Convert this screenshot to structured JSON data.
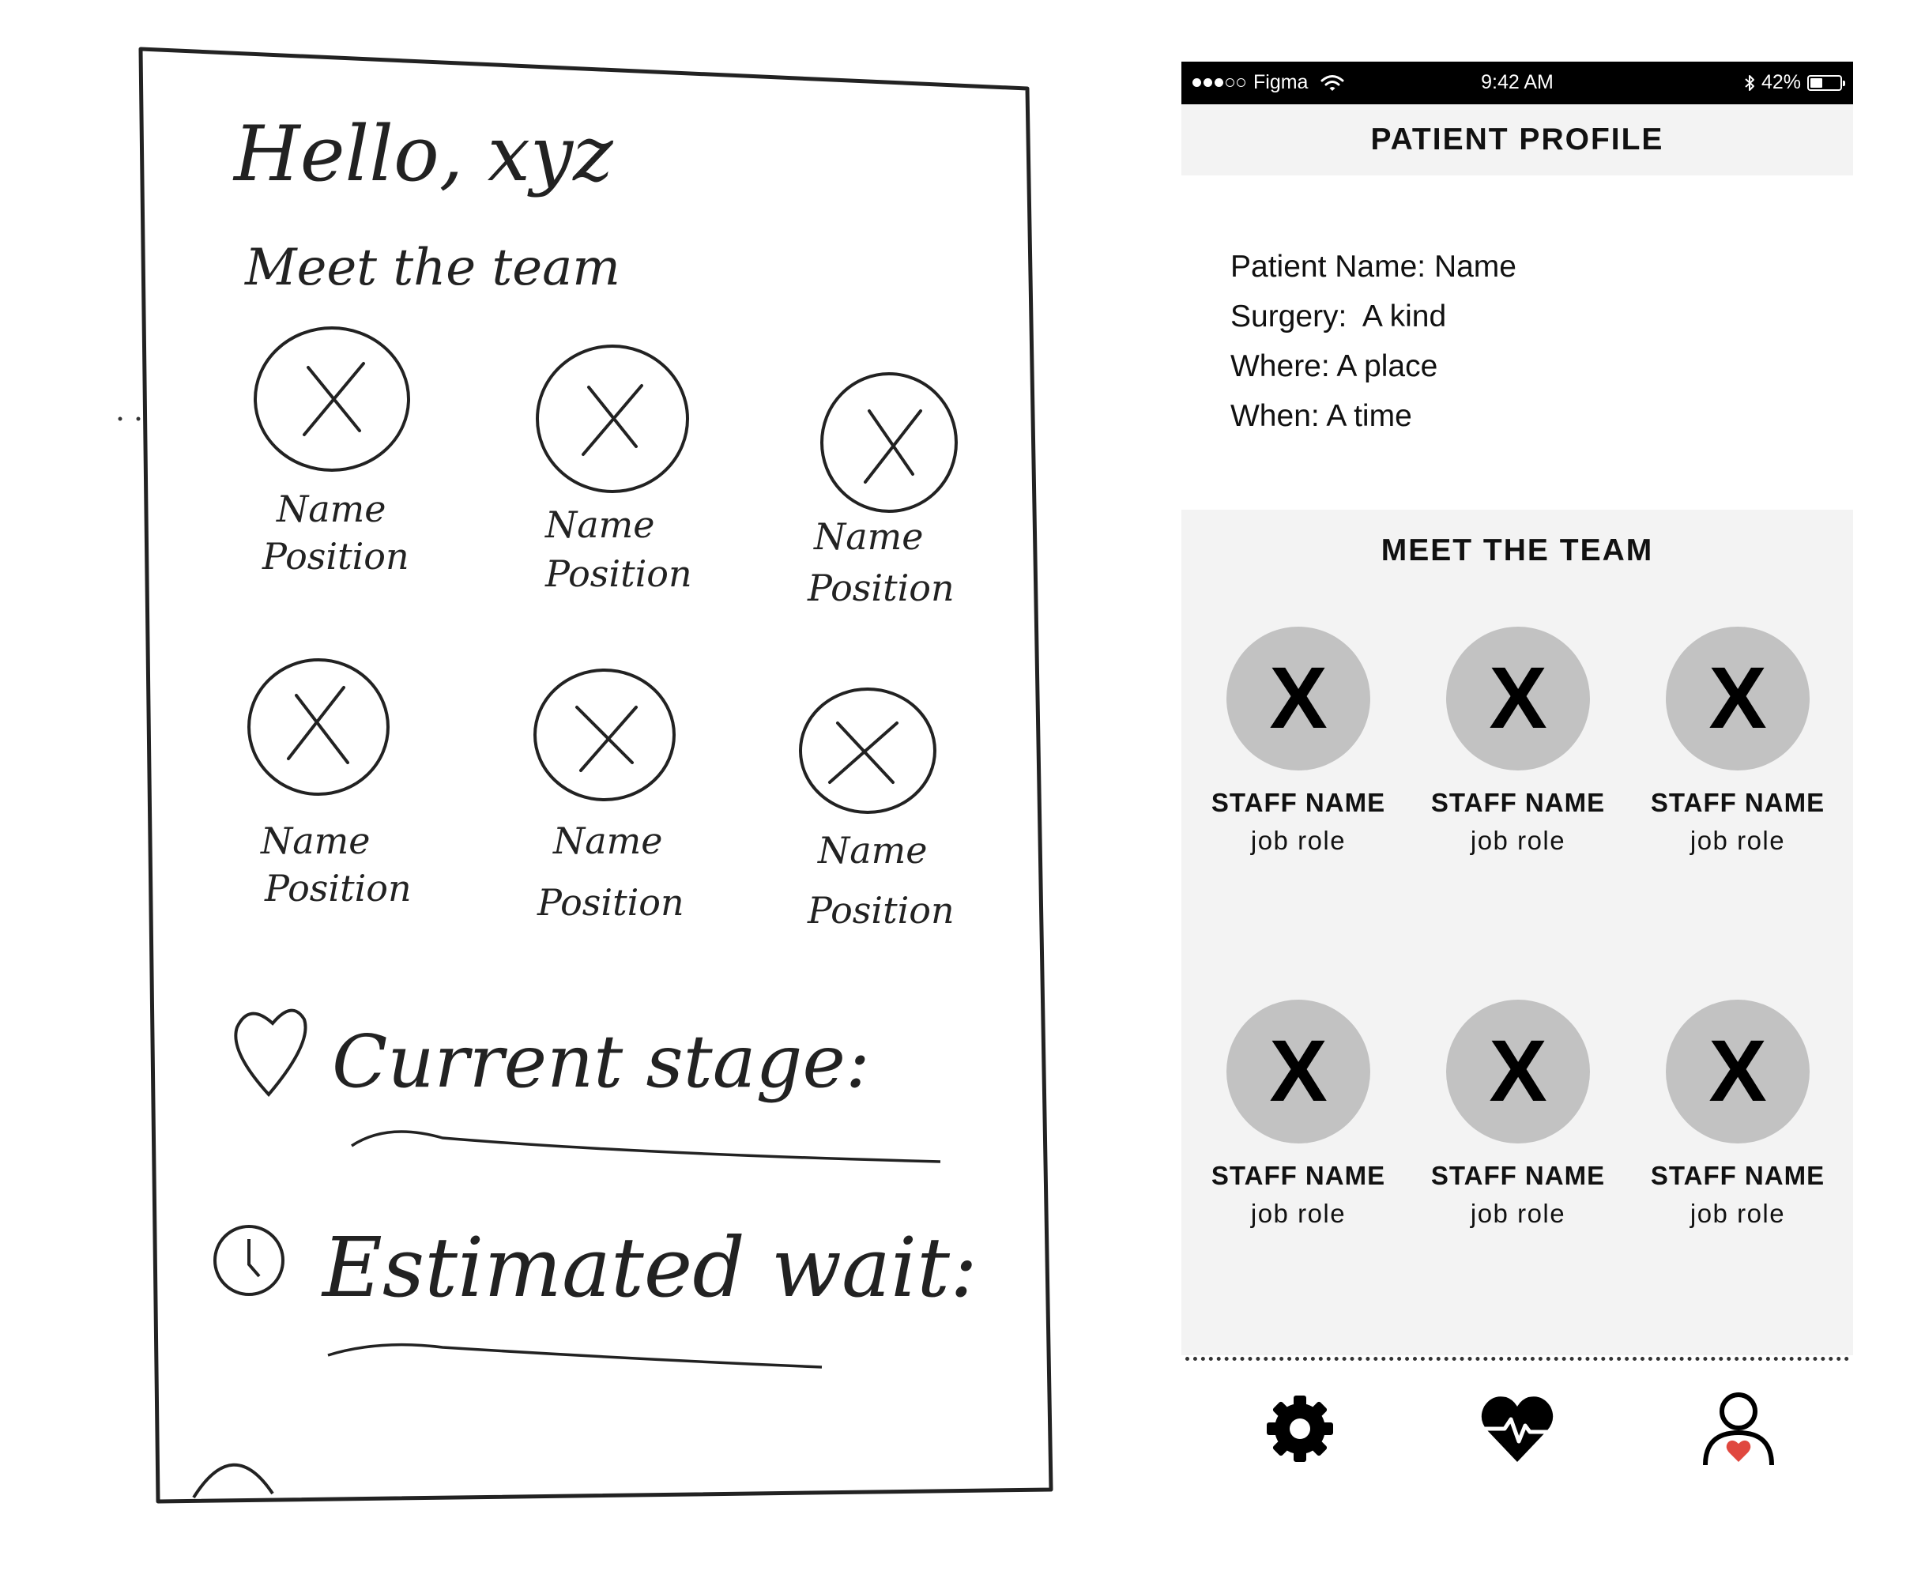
{
  "sketch": {
    "greeting": "Hello, xyz",
    "section_title": "Meet the team",
    "members": [
      {
        "name": "Name",
        "position": "Position"
      },
      {
        "name": "Name",
        "position": "Position"
      },
      {
        "name": "Name",
        "position": "Position"
      },
      {
        "name": "Name",
        "position": "Position"
      },
      {
        "name": "Name",
        "position": "Position"
      },
      {
        "name": "Name",
        "position": "Position"
      }
    ],
    "current_stage_label": "Current stage:",
    "estimated_wait_label": "Estimated wait:"
  },
  "status_bar": {
    "carrier": "Figma",
    "time": "9:42 AM",
    "battery": "42%",
    "battery_level": 0.42,
    "signal_bars_filled": 3,
    "signal_bars_total": 5
  },
  "header": {
    "title": "PATIENT PROFILE"
  },
  "patient": {
    "name_line": "Patient Name: Name",
    "surgery_line": "Surgery:  A kind",
    "where_line": "Where: A place",
    "when_line": "When: A time"
  },
  "team": {
    "title": "MEET THE TEAM",
    "members": [
      {
        "avatar": "X",
        "name": "STAFF NAME",
        "role": "job role"
      },
      {
        "avatar": "X",
        "name": "STAFF NAME",
        "role": "job role"
      },
      {
        "avatar": "X",
        "name": "STAFF NAME",
        "role": "job role"
      },
      {
        "avatar": "X",
        "name": "STAFF NAME",
        "role": "job role"
      },
      {
        "avatar": "X",
        "name": "STAFF NAME",
        "role": "job role"
      },
      {
        "avatar": "X",
        "name": "STAFF NAME",
        "role": "job role"
      }
    ]
  },
  "nav": {
    "items": [
      {
        "icon": "gear-icon"
      },
      {
        "icon": "heart-pulse-icon"
      },
      {
        "icon": "person-heart-icon"
      }
    ],
    "accent_color": "#e0483f"
  },
  "colors": {
    "header_bg": "#f3f3f3",
    "avatar_bg": "#c2c2c2",
    "status_bar_bg": "#000000"
  }
}
